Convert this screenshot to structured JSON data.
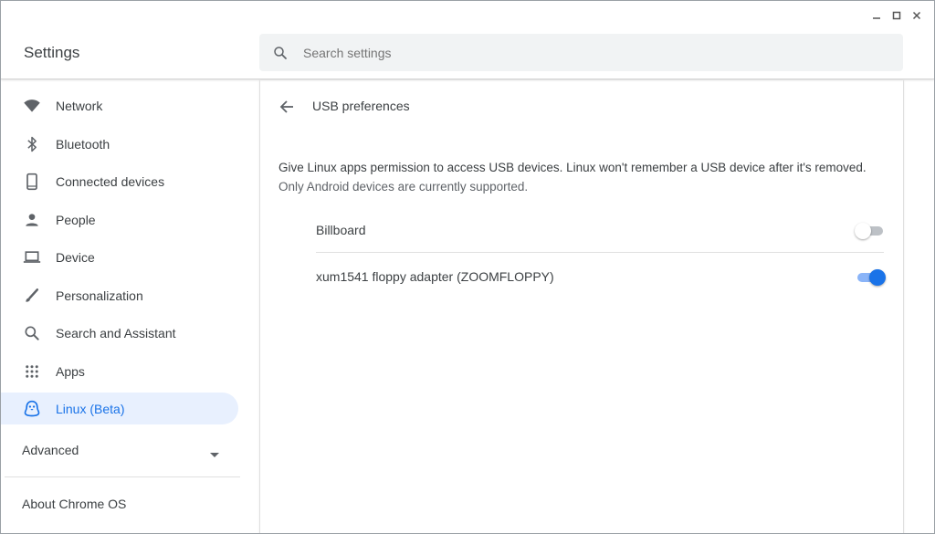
{
  "app": {
    "title": "Settings",
    "search_placeholder": "Search settings"
  },
  "sidebar": {
    "items": [
      {
        "label": "Network",
        "icon": "wifi-icon"
      },
      {
        "label": "Bluetooth",
        "icon": "bluetooth-icon"
      },
      {
        "label": "Connected devices",
        "icon": "phone-icon"
      },
      {
        "label": "People",
        "icon": "person-icon"
      },
      {
        "label": "Device",
        "icon": "laptop-icon"
      },
      {
        "label": "Personalization",
        "icon": "brush-icon"
      },
      {
        "label": "Search and Assistant",
        "icon": "search-icon"
      },
      {
        "label": "Apps",
        "icon": "apps-grid-icon"
      },
      {
        "label": "Linux (Beta)",
        "icon": "linux-penguin-icon",
        "active": true
      }
    ],
    "advanced_label": "Advanced",
    "about_label": "About Chrome OS"
  },
  "main": {
    "title": "USB preferences",
    "description": "Give Linux apps permission to access USB devices. Linux won't remember a USB device after it's removed.",
    "sub_description": "Only Android devices are currently supported.",
    "devices": [
      {
        "label": "Billboard",
        "enabled": false
      },
      {
        "label": "xum1541 floppy adapter (ZOOMFLOPPY)",
        "enabled": true
      }
    ]
  },
  "colors": {
    "accent": "#1a73e8",
    "active_bg": "#e8f0fe",
    "toggle_on_track": "#8ab4f8",
    "toggle_off_track": "#bdc1c6"
  }
}
